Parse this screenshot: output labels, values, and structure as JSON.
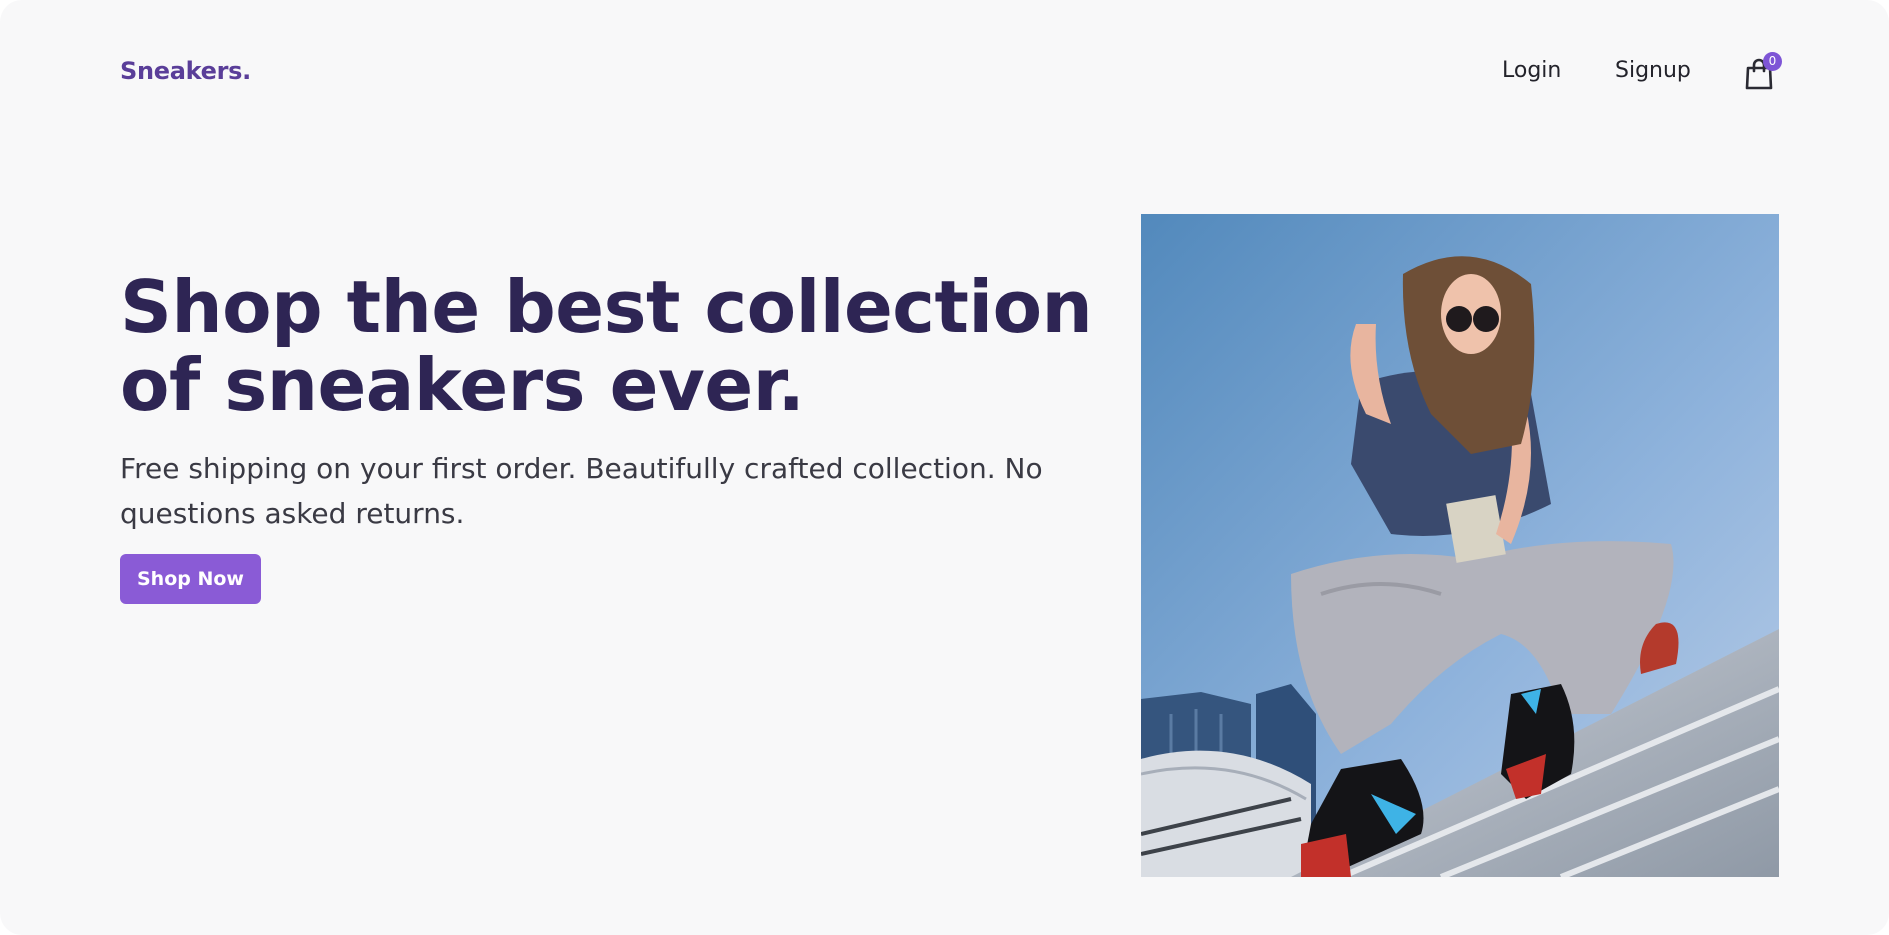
{
  "header": {
    "brand": "Sneakers.",
    "nav": {
      "login": "Login",
      "signup": "Signup"
    },
    "cart": {
      "icon": "shopping-bag-icon",
      "count": "0"
    }
  },
  "hero": {
    "title": "Shop the best collection of sneakers ever.",
    "subtitle": "Free shipping on your first order. Beautifully crafted collection. No questions asked returns.",
    "cta_label": "Shop Now",
    "image_icon": "hero-photo"
  },
  "colors": {
    "brand": "#5a3e99",
    "title": "#2e2554",
    "accent": "#8a5bd6",
    "background": "#f8f8f9"
  }
}
